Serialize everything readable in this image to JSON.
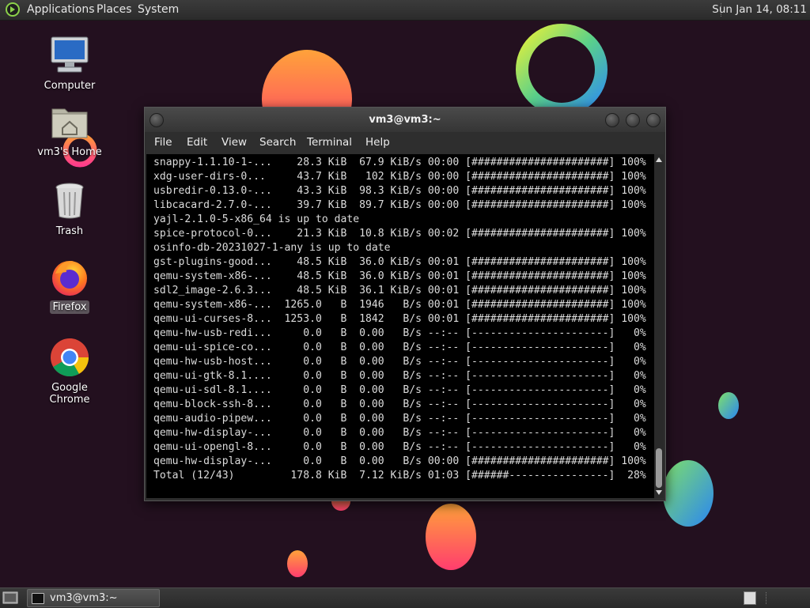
{
  "top_panel": {
    "menus": [
      "Applications",
      "Places",
      "System"
    ],
    "clock": "Sun Jan 14, 08:11"
  },
  "desktop": {
    "icons": [
      {
        "label": "Computer",
        "icon": "computer-icon"
      },
      {
        "label": "vm3's Home",
        "icon": "home-folder-icon"
      },
      {
        "label": "Trash",
        "icon": "trash-icon"
      },
      {
        "label": "Firefox",
        "icon": "firefox-icon",
        "selected": true
      },
      {
        "label": "Google Chrome",
        "icon": "chrome-icon"
      }
    ]
  },
  "terminal": {
    "title": "vm3@vm3:~",
    "menus": [
      "File",
      "Edit",
      "View",
      "Search",
      "Terminal",
      "Help"
    ],
    "lines": [
      "snappy-1.1.10-1-...    28.3 KiB  67.9 KiB/s 00:00 [######################] 100%",
      "xdg-user-dirs-0...     43.7 KiB   102 KiB/s 00:00 [######################] 100%",
      "usbredir-0.13.0-...    43.3 KiB  98.3 KiB/s 00:00 [######################] 100%",
      "libcacard-2.7.0-...    39.7 KiB  89.7 KiB/s 00:00 [######################] 100%",
      "yajl-2.1.0-5-x86_64 is up to date",
      "spice-protocol-0...    21.3 KiB  10.8 KiB/s 00:02 [######################] 100%",
      "osinfo-db-20231027-1-any is up to date",
      "gst-plugins-good...    48.5 KiB  36.0 KiB/s 00:01 [######################] 100%",
      "qemu-system-x86-...    48.5 KiB  36.0 KiB/s 00:01 [######################] 100%",
      "sdl2_image-2.6.3...    48.5 KiB  36.1 KiB/s 00:01 [######################] 100%",
      "qemu-system-x86-...  1265.0   B  1946   B/s 00:01 [######################] 100%",
      "qemu-ui-curses-8...  1253.0   B  1842   B/s 00:01 [######################] 100%",
      "qemu-hw-usb-redi...     0.0   B  0.00   B/s --:-- [----------------------]   0%",
      "qemu-ui-spice-co...     0.0   B  0.00   B/s --:-- [----------------------]   0%",
      "qemu-hw-usb-host...     0.0   B  0.00   B/s --:-- [----------------------]   0%",
      "qemu-ui-gtk-8.1....     0.0   B  0.00   B/s --:-- [----------------------]   0%",
      "qemu-ui-sdl-8.1....     0.0   B  0.00   B/s --:-- [----------------------]   0%",
      "qemu-block-ssh-8...     0.0   B  0.00   B/s --:-- [----------------------]   0%",
      "qemu-audio-pipew...     0.0   B  0.00   B/s --:-- [----------------------]   0%",
      "qemu-hw-display-...     0.0   B  0.00   B/s --:-- [----------------------]   0%",
      "qemu-ui-opengl-8...     0.0   B  0.00   B/s --:-- [----------------------]   0%",
      "qemu-hw-display-...     0.0   B  0.00   B/s 00:00 [######################] 100%",
      "Total (12/43)         178.8 KiB  7.12 KiB/s 01:03 [######----------------]  28%"
    ]
  },
  "taskbar": {
    "tasks": [
      {
        "label": "vm3@vm3:~",
        "icon": "terminal-icon"
      }
    ]
  },
  "colors": {
    "desktop_bg": "#23101f",
    "panel": "#2f2f2f",
    "terminal_bg": "#000000",
    "terminal_fg": "#dcdcdc"
  }
}
